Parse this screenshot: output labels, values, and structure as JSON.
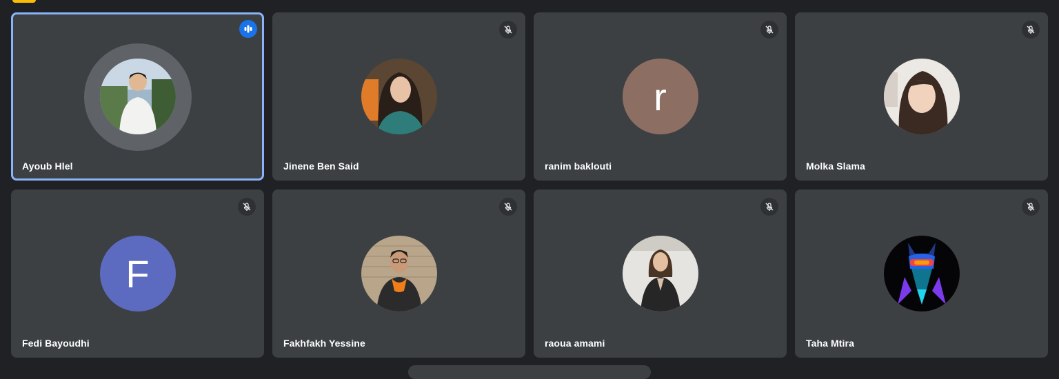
{
  "participants": [
    {
      "name": "Ayoub Hlel",
      "avatar_type": "photo",
      "speaking": true
    },
    {
      "name": "Jinene Ben Said",
      "avatar_type": "photo",
      "muted": true
    },
    {
      "name": "ranim baklouti",
      "avatar_type": "letter",
      "initial": "r",
      "avatar_color": "#8d6e63",
      "muted": true
    },
    {
      "name": "Molka Slama",
      "avatar_type": "photo",
      "muted": true
    },
    {
      "name": "Fedi Bayoudhi",
      "avatar_type": "letter",
      "initial": "F",
      "avatar_color": "#5c6bc0",
      "muted": true
    },
    {
      "name": "Fakhfakh Yessine",
      "avatar_type": "photo",
      "muted": true
    },
    {
      "name": "raoua amami",
      "avatar_type": "photo",
      "muted": true
    },
    {
      "name": "Taha Mtira",
      "avatar_type": "photo",
      "muted": true
    }
  ],
  "icons": {
    "mic_off": "mic-off-icon",
    "speaking": "audio-level-icon"
  },
  "colors": {
    "background": "#202124",
    "tile": "#3c4043",
    "active_border": "#8ab4f8",
    "speaking_badge": "#1a73e8"
  }
}
